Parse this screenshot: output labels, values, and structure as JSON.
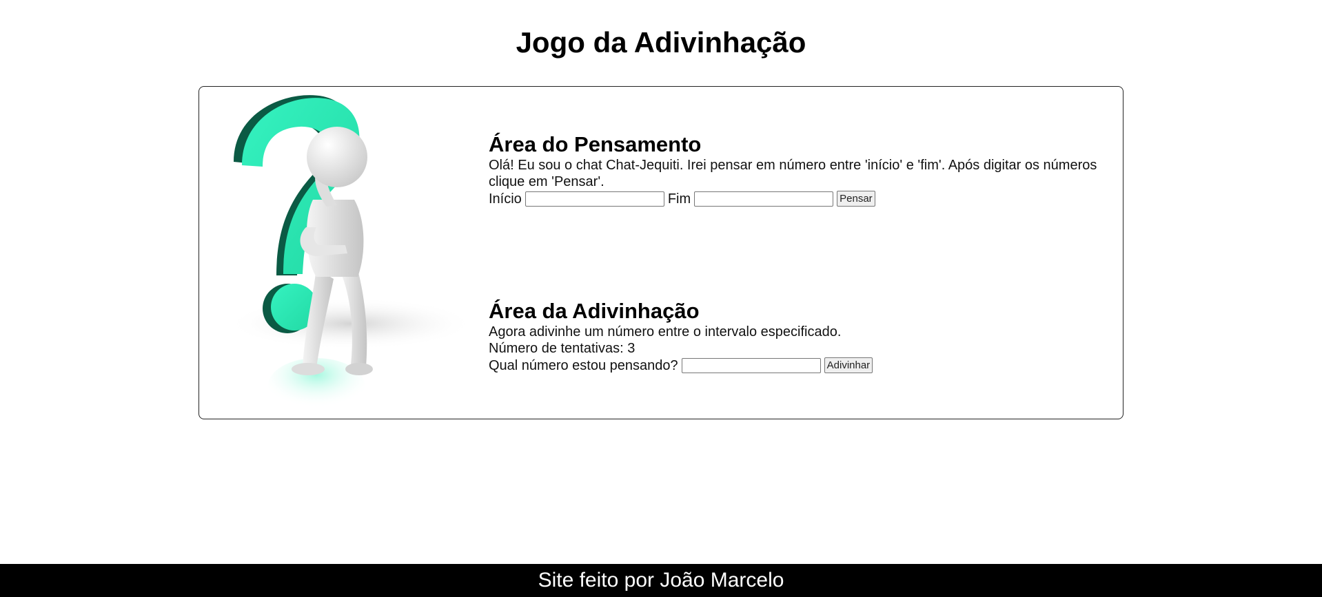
{
  "page": {
    "title": "Jogo da Adivinhação"
  },
  "thinking": {
    "heading": "Área do Pensamento",
    "description": "Olá! Eu sou o chat Chat-Jequiti. Irei pensar em número entre 'início' e 'fim'. Após digitar os números clique em 'Pensar'.",
    "start_label": "Início",
    "start_value": "",
    "end_label": "Fim",
    "end_value": "",
    "think_button": "Pensar"
  },
  "guessing": {
    "heading": "Área da Adivinhação",
    "instruction": "Agora adivinhe um número entre o intervalo especificado.",
    "attempts_text": "Número de tentativas: 3",
    "question_label": "Qual número estou pensando?",
    "guess_value": "",
    "guess_button": "Adivinhar"
  },
  "footer": {
    "text": "Site feito por João Marcelo"
  },
  "colors": {
    "accent_green": "#2ee8b4",
    "dark_green": "#0b5a44",
    "footer_bg": "#000000",
    "footer_text": "#ffffff"
  },
  "icons": {
    "illustration": "thinking-figure-question-mark"
  }
}
